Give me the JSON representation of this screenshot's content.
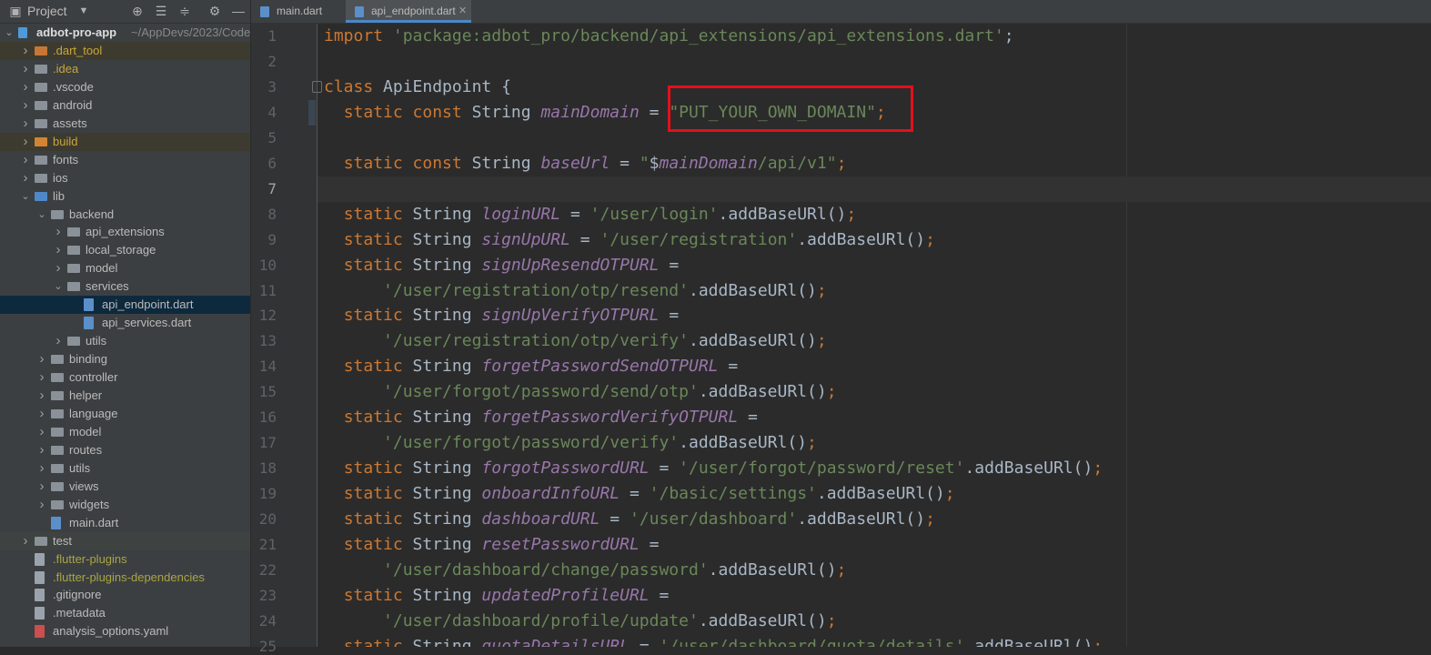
{
  "project_panel": {
    "title": "Project",
    "tree": [
      {
        "label": "adbot-pro-app",
        "extra": "~/AppDevs/2023/Code",
        "depth": 0,
        "arrow": "down",
        "icon": "flutter-project"
      },
      {
        "label": ".dart_tool",
        "depth": 1,
        "arrow": "right",
        "icon": "folder-orange"
      },
      {
        "label": ".idea",
        "depth": 1,
        "arrow": "right",
        "icon": "folder-settings"
      },
      {
        "label": ".vscode",
        "depth": 1,
        "arrow": "right",
        "icon": "folder"
      },
      {
        "label": "android",
        "depth": 1,
        "arrow": "right",
        "icon": "folder"
      },
      {
        "label": "assets",
        "depth": 1,
        "arrow": "right",
        "icon": "folder"
      },
      {
        "label": "build",
        "depth": 1,
        "arrow": "right",
        "icon": "folder-excluded"
      },
      {
        "label": "fonts",
        "depth": 1,
        "arrow": "right",
        "icon": "folder"
      },
      {
        "label": "ios",
        "depth": 1,
        "arrow": "right",
        "icon": "folder"
      },
      {
        "label": "lib",
        "depth": 1,
        "arrow": "down",
        "icon": "folder-source"
      },
      {
        "label": "backend",
        "depth": 2,
        "arrow": "down",
        "icon": "folder"
      },
      {
        "label": "api_extensions",
        "depth": 3,
        "arrow": "right",
        "icon": "folder"
      },
      {
        "label": "local_storage",
        "depth": 3,
        "arrow": "right",
        "icon": "folder"
      },
      {
        "label": "model",
        "depth": 3,
        "arrow": "right",
        "icon": "folder"
      },
      {
        "label": "services",
        "depth": 3,
        "arrow": "down",
        "icon": "folder"
      },
      {
        "label": "api_endpoint.dart",
        "depth": 4,
        "arrow": "",
        "icon": "dart-file"
      },
      {
        "label": "api_services.dart",
        "depth": 4,
        "arrow": "",
        "icon": "dart-file"
      },
      {
        "label": "utils",
        "depth": 3,
        "arrow": "right",
        "icon": "folder"
      },
      {
        "label": "binding",
        "depth": 2,
        "arrow": "right",
        "icon": "folder"
      },
      {
        "label": "controller",
        "depth": 2,
        "arrow": "right",
        "icon": "folder"
      },
      {
        "label": "helper",
        "depth": 2,
        "arrow": "right",
        "icon": "folder"
      },
      {
        "label": "language",
        "depth": 2,
        "arrow": "right",
        "icon": "folder"
      },
      {
        "label": "model",
        "depth": 2,
        "arrow": "right",
        "icon": "folder"
      },
      {
        "label": "routes",
        "depth": 2,
        "arrow": "right",
        "icon": "folder"
      },
      {
        "label": "utils",
        "depth": 2,
        "arrow": "right",
        "icon": "folder"
      },
      {
        "label": "views",
        "depth": 2,
        "arrow": "right",
        "icon": "folder"
      },
      {
        "label": "widgets",
        "depth": 2,
        "arrow": "right",
        "icon": "folder"
      },
      {
        "label": "main.dart",
        "depth": 2,
        "arrow": "",
        "icon": "dart-file"
      },
      {
        "label": "test",
        "depth": 1,
        "arrow": "right",
        "icon": "folder-test"
      },
      {
        "label": ".flutter-plugins",
        "depth": 1,
        "arrow": "",
        "icon": "text-file"
      },
      {
        "label": ".flutter-plugins-dependencies",
        "depth": 1,
        "arrow": "",
        "icon": "text-file"
      },
      {
        "label": ".gitignore",
        "depth": 1,
        "arrow": "",
        "icon": "text-file"
      },
      {
        "label": ".metadata",
        "depth": 1,
        "arrow": "",
        "icon": "text-file"
      },
      {
        "label": "analysis_options.yaml",
        "depth": 1,
        "arrow": "",
        "icon": "yaml-file"
      }
    ]
  },
  "tabs": [
    {
      "label": "main.dart",
      "active": false
    },
    {
      "label": "api_endpoint.dart",
      "active": true
    }
  ],
  "editor": {
    "current_line": 7,
    "highlighted_text": "\"PUT_YOUR_OWN_DOMAIN\";",
    "lines": [
      {
        "n": "1",
        "segs": [
          [
            "kw",
            "import "
          ],
          [
            "str",
            "'package:adbot_pro/backend/api_extensions/api_extensions.dart'"
          ],
          [
            "",
            "; "
          ]
        ]
      },
      {
        "n": "2",
        "segs": []
      },
      {
        "n": "3",
        "segs": [
          [
            "kw",
            "class "
          ],
          [
            "",
            "ApiEndpoint {"
          ]
        ]
      },
      {
        "n": "4",
        "segs": [
          [
            "",
            "  "
          ],
          [
            "kw",
            "static const "
          ],
          [
            "",
            "String "
          ],
          [
            "fld",
            "mainDomain"
          ],
          [
            "",
            " = "
          ],
          [
            "str",
            "\"PUT_YOUR_OWN_DOMAIN\""
          ],
          [
            "kw",
            ";"
          ]
        ]
      },
      {
        "n": "5",
        "segs": []
      },
      {
        "n": "6",
        "segs": [
          [
            "",
            "  "
          ],
          [
            "kw",
            "static const "
          ],
          [
            "",
            "String "
          ],
          [
            "fld",
            "baseUrl"
          ],
          [
            "",
            " = "
          ],
          [
            "str",
            "\""
          ],
          [
            "",
            "$"
          ],
          [
            "strf",
            "mainDomain"
          ],
          [
            "str",
            "/api/v1\""
          ],
          [
            "kw",
            ";"
          ]
        ]
      },
      {
        "n": "7",
        "segs": []
      },
      {
        "n": "8",
        "segs": [
          [
            "",
            "  "
          ],
          [
            "kw",
            "static "
          ],
          [
            "",
            "String "
          ],
          [
            "fld",
            "loginURL"
          ],
          [
            "",
            " = "
          ],
          [
            "str",
            "'/user/login'"
          ],
          [
            "",
            ".addBaseURl()"
          ],
          [
            "kw",
            ";"
          ]
        ]
      },
      {
        "n": "9",
        "segs": [
          [
            "",
            "  "
          ],
          [
            "kw",
            "static "
          ],
          [
            "",
            "String "
          ],
          [
            "fld",
            "signUpURL"
          ],
          [
            "",
            " = "
          ],
          [
            "str",
            "'/user/registration'"
          ],
          [
            "",
            ".addBaseURl()"
          ],
          [
            "kw",
            ";"
          ]
        ]
      },
      {
        "n": "10",
        "segs": [
          [
            "",
            "  "
          ],
          [
            "kw",
            "static "
          ],
          [
            "",
            "String "
          ],
          [
            "fld",
            "signUpResendOTPURL"
          ],
          [
            "",
            " ="
          ]
        ]
      },
      {
        "n": "11",
        "segs": [
          [
            "",
            "      "
          ],
          [
            "str",
            "'/user/registration/otp/resend'"
          ],
          [
            "",
            ".addBaseURl()"
          ],
          [
            "kw",
            ";"
          ]
        ]
      },
      {
        "n": "12",
        "segs": [
          [
            "",
            "  "
          ],
          [
            "kw",
            "static "
          ],
          [
            "",
            "String "
          ],
          [
            "fld",
            "signUpVerifyOTPURL"
          ],
          [
            "",
            " ="
          ]
        ]
      },
      {
        "n": "13",
        "segs": [
          [
            "",
            "      "
          ],
          [
            "str",
            "'/user/registration/otp/verify'"
          ],
          [
            "",
            ".addBaseURl()"
          ],
          [
            "kw",
            ";"
          ]
        ]
      },
      {
        "n": "14",
        "segs": [
          [
            "",
            "  "
          ],
          [
            "kw",
            "static "
          ],
          [
            "",
            "String "
          ],
          [
            "fld",
            "forgetPasswordSendOTPURL"
          ],
          [
            "",
            " ="
          ]
        ]
      },
      {
        "n": "15",
        "segs": [
          [
            "",
            "      "
          ],
          [
            "str",
            "'/user/forgot/password/send/otp'"
          ],
          [
            "",
            ".addBaseURl()"
          ],
          [
            "kw",
            ";"
          ]
        ]
      },
      {
        "n": "16",
        "segs": [
          [
            "",
            "  "
          ],
          [
            "kw",
            "static "
          ],
          [
            "",
            "String "
          ],
          [
            "fld",
            "forgetPasswordVerifyOTPURL"
          ],
          [
            "",
            " ="
          ]
        ]
      },
      {
        "n": "17",
        "segs": [
          [
            "",
            "      "
          ],
          [
            "str",
            "'/user/forgot/password/verify'"
          ],
          [
            "",
            ".addBaseURl()"
          ],
          [
            "kw",
            ";"
          ]
        ]
      },
      {
        "n": "18",
        "segs": [
          [
            "",
            "  "
          ],
          [
            "kw",
            "static "
          ],
          [
            "",
            "String "
          ],
          [
            "fld",
            "forgotPasswordURL"
          ],
          [
            "",
            " = "
          ],
          [
            "str",
            "'/user/forgot/password/reset'"
          ],
          [
            "",
            ".addBaseURl()"
          ],
          [
            "kw",
            ";"
          ]
        ]
      },
      {
        "n": "19",
        "segs": [
          [
            "",
            "  "
          ],
          [
            "kw",
            "static "
          ],
          [
            "",
            "String "
          ],
          [
            "fld",
            "onboardInfoURL"
          ],
          [
            "",
            " = "
          ],
          [
            "str",
            "'/basic/settings'"
          ],
          [
            "",
            ".addBaseURl()"
          ],
          [
            "kw",
            ";"
          ]
        ]
      },
      {
        "n": "20",
        "segs": [
          [
            "",
            "  "
          ],
          [
            "kw",
            "static "
          ],
          [
            "",
            "String "
          ],
          [
            "fld",
            "dashboardURL"
          ],
          [
            "",
            " = "
          ],
          [
            "str",
            "'/user/dashboard'"
          ],
          [
            "",
            ".addBaseURl()"
          ],
          [
            "kw",
            ";"
          ]
        ]
      },
      {
        "n": "21",
        "segs": [
          [
            "",
            "  "
          ],
          [
            "kw",
            "static "
          ],
          [
            "",
            "String "
          ],
          [
            "fld",
            "resetPasswordURL"
          ],
          [
            "",
            " ="
          ]
        ]
      },
      {
        "n": "22",
        "segs": [
          [
            "",
            "      "
          ],
          [
            "str",
            "'/user/dashboard/change/password'"
          ],
          [
            "",
            ".addBaseURl()"
          ],
          [
            "kw",
            ";"
          ]
        ]
      },
      {
        "n": "23",
        "segs": [
          [
            "",
            "  "
          ],
          [
            "kw",
            "static "
          ],
          [
            "",
            "String "
          ],
          [
            "fld",
            "updatedProfileURL"
          ],
          [
            "",
            " ="
          ]
        ]
      },
      {
        "n": "24",
        "segs": [
          [
            "",
            "      "
          ],
          [
            "str",
            "'/user/dashboard/profile/update'"
          ],
          [
            "",
            ".addBaseURl()"
          ],
          [
            "kw",
            ";"
          ]
        ]
      },
      {
        "n": "25",
        "segs": [
          [
            "",
            "  "
          ],
          [
            "kw",
            "static "
          ],
          [
            "",
            "String "
          ],
          [
            "fld",
            "quotaDetailsURL"
          ],
          [
            "",
            " = "
          ],
          [
            "str",
            "'/user/dashboard/quota/details'"
          ],
          [
            "",
            ".addBaseURl()"
          ],
          [
            "kw",
            ";"
          ]
        ]
      }
    ]
  },
  "colors": {
    "background": "#2b2b2b",
    "keyword": "#cc7832",
    "string": "#6a8759",
    "field": "#9876aa",
    "plain": "#a9b7c6",
    "highlight_box": "#e3101a",
    "selection": "#0d293e"
  }
}
